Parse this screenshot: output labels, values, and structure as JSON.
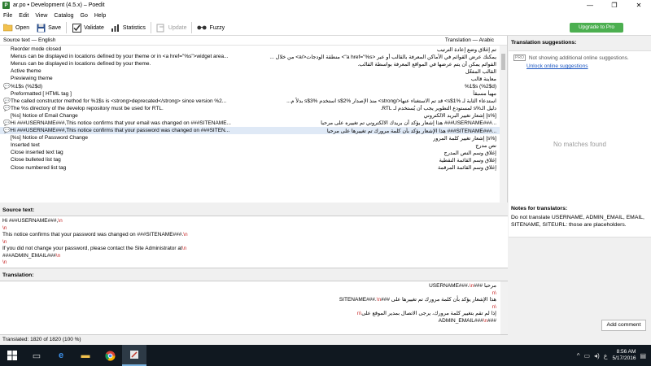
{
  "window": {
    "title": "ar.po • Development (4.5.x) – Poedit",
    "app_icon": "P"
  },
  "menu": [
    "File",
    "Edit",
    "View",
    "Catalog",
    "Go",
    "Help"
  ],
  "toolbar": {
    "open": "Open",
    "save": "Save",
    "validate": "Validate",
    "statistics": "Statistics",
    "update": "Update",
    "fuzzy": "Fuzzy",
    "upgrade": "Upgrade to Pro"
  },
  "list": {
    "source_header": "Source text — English",
    "translation_header": "Translation — Arabic",
    "rows": [
      {
        "mark": "",
        "source": "Reorder mode closed",
        "translation": "تم إغلاق وضع إعادة الترتيب"
      },
      {
        "mark": "",
        "source": "Menus can be displayed in locations defined by your theme or in <a href=\"%s\">widget area...",
        "translation": "يمكنك عرض القوائم في الأماكن المعرفة بالقالب أو عبر <a href=\"%s\"> منطقة الودجات</a> من خلال ..."
      },
      {
        "mark": "",
        "source": "Menus can be displayed in locations defined by your theme.",
        "translation": "القوائم يمكن أن يتم عرضها في المواقع المعرفة بواسطة القالب."
      },
      {
        "mark": "",
        "source": "Active theme",
        "translation": "القالب المفعّل"
      },
      {
        "mark": "",
        "source": "Previewing theme",
        "translation": "معاينة قالب"
      },
      {
        "mark": "💬",
        "source": "%1$s (%2$d)",
        "translation": "%1$s (%2$d)"
      },
      {
        "mark": "",
        "source": "Preformatted   [ HTML tag ]",
        "translation": "مهيأ مسبقاً"
      },
      {
        "mark": "💬",
        "source": "The called constructor method for %1$s is <strong>deprecated</strong> since version %2...",
        "translation": "استدعاء الثابة لـ %1$s> قد تم الاستغناء عنها</strong> منذ الإصدار %2$s استخدم %3$s بدلاً م..."
      },
      {
        "mark": "💬",
        "source": "The %s directory of the develop repository must be used for RTL.",
        "translation": "دليل الـ%s لمستودع التطوير يجب أن يُستخدم لـ RTL."
      },
      {
        "mark": "",
        "source": "[%s] Notice of Email Change",
        "translation": "[%s] إشعار تغيير البريد الالكتروني"
      },
      {
        "mark": "💬",
        "source": "Hi ###USERNAME###,This notice confirms that your email was changed on ###SITENAME...",
        "translation": "...###USERNAME### هذا إشعار يؤكد أن بريدك الالكتروني تم تغييره على مرحبا"
      },
      {
        "mark": "💬",
        "source": "Hi ###USERNAME###,This notice confirms that your password was changed on ###SITEN...",
        "translation": "...###SITENAME### هذا الإشعار يؤكد بأن كلمة مرورك تم تغييرها على مرحبا"
      },
      {
        "mark": "",
        "source": "[%s] Notice of Password Change",
        "translation": "[%s] إشعار تغيير كلمة المرور"
      },
      {
        "mark": "",
        "source": "Inserted text",
        "translation": "نص مدرج"
      },
      {
        "mark": "",
        "source": "Close inserted text tag",
        "translation": "إغلاق وسم النص المدرج"
      },
      {
        "mark": "",
        "source": "Close bulleted list tag",
        "translation": "إغلاق وسم القائمة النقطية"
      },
      {
        "mark": "",
        "source": "Close numbered list tag",
        "translation": "إغلاق وسم القائمة المرقمة"
      }
    ]
  },
  "source_panel": {
    "label": "Source text:",
    "lines": [
      {
        "text": "Hi ###USERNAME###,",
        "esc": "\\n"
      },
      {
        "text": "",
        "esc": "\\n"
      },
      {
        "text": "This notice confirms that your password was changed on ###SITENAME###.",
        "esc": "\\n"
      },
      {
        "text": "",
        "esc": "\\n"
      },
      {
        "text": "If you did not change your password, please contact the Site Administrator at",
        "esc": "\\n"
      },
      {
        "text": "###ADMIN_EMAIL###",
        "esc": "\\n"
      },
      {
        "text": "",
        "esc": "\\n"
      }
    ]
  },
  "translation_panel": {
    "label": "Translation:",
    "lines": [
      {
        "text": "مرحبا ###USERNAME###،",
        "esc": "\\n"
      },
      {
        "text": "",
        "esc": "\\n"
      },
      {
        "text": "هذا الإشعار يؤكد بأن كلمة مرورك تم تغييرها على ###SITENAME###.",
        "esc": "\\n"
      },
      {
        "text": "",
        "esc": "\\n"
      },
      {
        "text": "إذا لم تقم بتغيير كلمة مرورك، يرجى الاتصال بمدير الموقع على",
        "esc": "\\n"
      },
      {
        "text": "###ADMIN_EMAIL###",
        "esc": "\\n"
      }
    ]
  },
  "side": {
    "suggestions_title": "Translation suggestions:",
    "pro_badge": "PRO",
    "not_showing": "Not showing additional online suggestions.",
    "unlock_link": "Unlock online suggestions",
    "no_matches": "No matches found",
    "notes_title": "Notes for translators:",
    "notes_text": "Do not translate USERNAME, ADMIN_EMAIL, EMAIL, SITENAME, SITEURL: those are placeholders.",
    "add_comment": "Add comment"
  },
  "status": {
    "text": "Translated: 1820 of 1820 (100 %)"
  },
  "taskbar": {
    "time": "8:56 AM",
    "date": "5/17/2016",
    "lang": "ع"
  }
}
